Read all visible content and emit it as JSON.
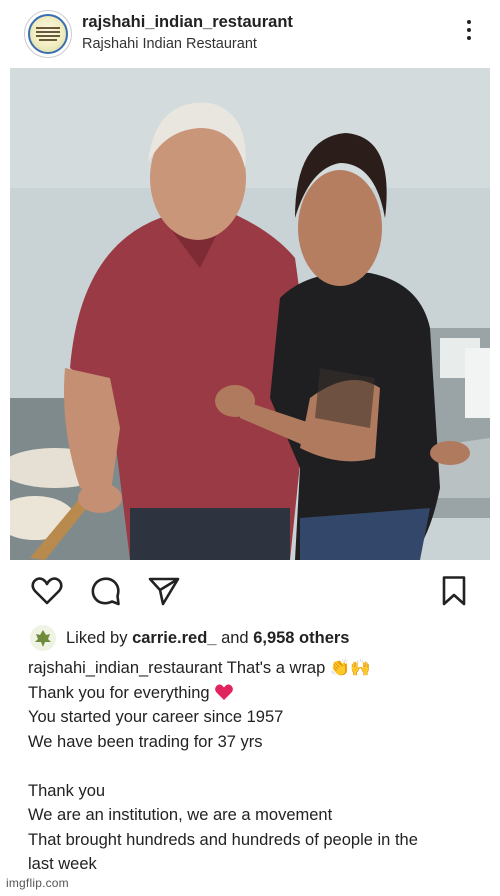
{
  "post": {
    "username": "rajshahi_indian_restaurant",
    "subtitle": "Rajshahi Indian Restaurant",
    "avatar_icon": "restaurant-logo-icon"
  },
  "actions": {
    "like_icon": "heart-outline-icon",
    "comment_icon": "comment-icon",
    "share_icon": "send-icon",
    "save_icon": "bookmark-icon"
  },
  "likes": {
    "prefix": "Liked by",
    "liker": "carrie.red_",
    "conjunction": "and",
    "others": "6,958 others"
  },
  "caption": {
    "username": "rajshahi_indian_restaurant",
    "first_text": "That's a wrap",
    "first_emojis": "👏🙌",
    "lines": [
      "Thank you for everything",
      "You started your career since 1957",
      "We have been trading for 37 yrs",
      "",
      "Thank you",
      "We are an institution, we are a movement",
      "That brought hundreds and hundreds of people in the",
      "last week"
    ]
  },
  "watermark": "imgflip.com",
  "colors": {
    "text": "#222222",
    "heart": "#e0245e",
    "shirt_red": "#9a3a44",
    "tshirt_black": "#1f1f22"
  }
}
